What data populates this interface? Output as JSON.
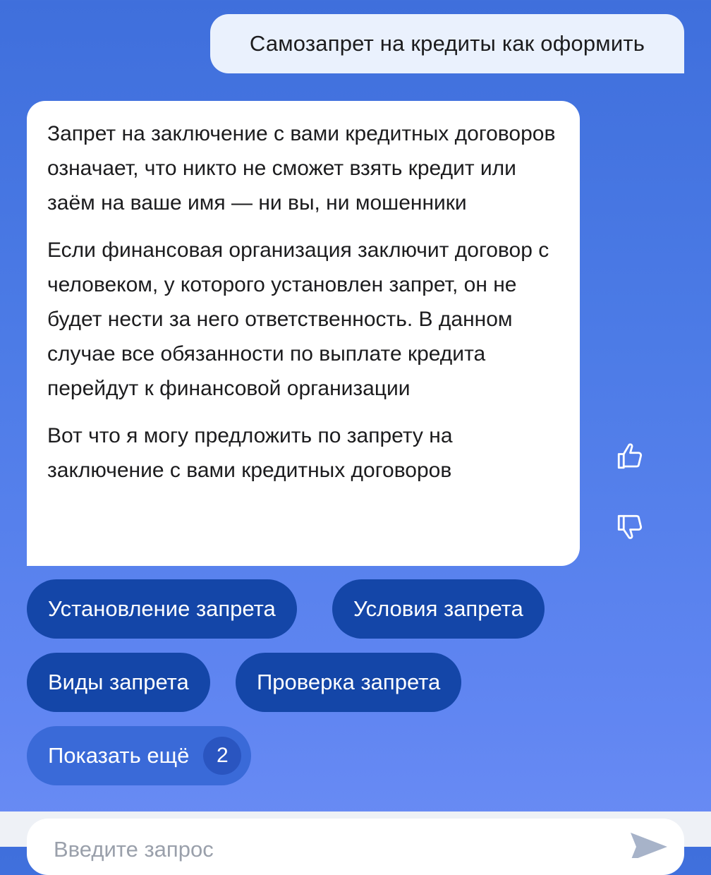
{
  "user_message": "Самозапрет на кредиты как оформить",
  "bot_message": {
    "paragraphs": [
      "Запрет на заключение с вами кредитных договоров означает, что никто не сможет взять кредит или заём на ваше имя — ни вы, ни мошенники",
      "Если финансовая организация заключит договор с человеком, у которого установлен запрет, он не будет нести за него ответственность. В данном случае все обязанности по выплате кредита перейдут к финансовой организации",
      "Вот что я могу предложить по запрету на заключение с вами кредитных договоров"
    ]
  },
  "feedback": {
    "like_icon": "thumbs-up-icon",
    "dislike_icon": "thumbs-down-icon"
  },
  "suggestions": [
    "Установление запрета",
    "Условия запрета",
    "Виды запрета",
    "Проверка запрета"
  ],
  "show_more": {
    "label": "Показать ещё",
    "count": "2"
  },
  "input": {
    "placeholder": "Введите запрос"
  },
  "colors": {
    "background_top": "#3f6fdc",
    "background_bottom": "#6a8cf4",
    "chip": "#1446a8",
    "chip_more": "#3a6ad8",
    "user_bubble": "#eaf1fd"
  }
}
